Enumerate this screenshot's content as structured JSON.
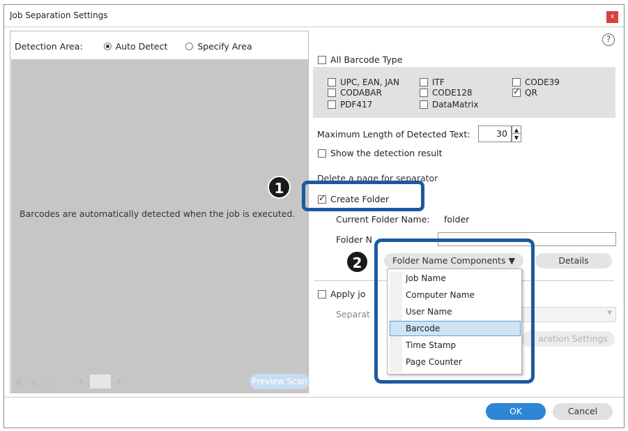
{
  "window": {
    "title": "Job Separation Settings",
    "close_glyph": "x"
  },
  "detection": {
    "label": "Detection Area:",
    "options": [
      "Auto Detect",
      "Specify Area"
    ],
    "selected": "Auto Detect"
  },
  "preview": {
    "message": "Barcodes are automatically detected when the job is executed.",
    "zoom_icons": "⊕ ⊖ ⛶",
    "prev_glyph": "‹",
    "next_glyph": "›",
    "scan_button": "Preview Scan"
  },
  "help_glyph": "?",
  "barcode": {
    "all_label": "All Barcode Type",
    "all_checked": false,
    "types": [
      {
        "label": "UPC, EAN, JAN",
        "checked": false
      },
      {
        "label": "ITF",
        "checked": false
      },
      {
        "label": "CODE39",
        "checked": false
      },
      {
        "label": "CODABAR",
        "checked": false
      },
      {
        "label": "CODE128",
        "checked": false
      },
      {
        "label": "QR",
        "checked": true
      },
      {
        "label": "PDF417",
        "checked": false
      },
      {
        "label": "DataMatrix",
        "checked": false
      }
    ]
  },
  "max_length": {
    "label": "Maximum Length of Detected Text:",
    "value": "30"
  },
  "show_result": {
    "label": "Show the detection result",
    "checked": false
  },
  "delete_page_partial": "Delete a page for separator",
  "create_folder": {
    "label": "Create Folder",
    "checked": true,
    "current_label": "Current Folder Name:",
    "current_value": "folder",
    "name_label": "Folder N",
    "components_button": "Folder Name Components ▼",
    "details_button": "Details"
  },
  "apply_job": {
    "label": "Apply jo",
    "checked": false,
    "separator_label": "Separat",
    "settings_button": "aration Settings"
  },
  "dropdown_items": [
    "Job Name",
    "Computer Name",
    "User Name",
    "Barcode",
    "Time Stamp",
    "Page Counter"
  ],
  "dropdown_selected": "Barcode",
  "callouts": [
    "1",
    "2"
  ],
  "footer": {
    "ok": "OK",
    "cancel": "Cancel"
  },
  "colors": {
    "callout": "#1c5a9e",
    "ok_button": "#2e86d4",
    "close_button": "#d9413c",
    "selection": "#cfe3f5"
  }
}
